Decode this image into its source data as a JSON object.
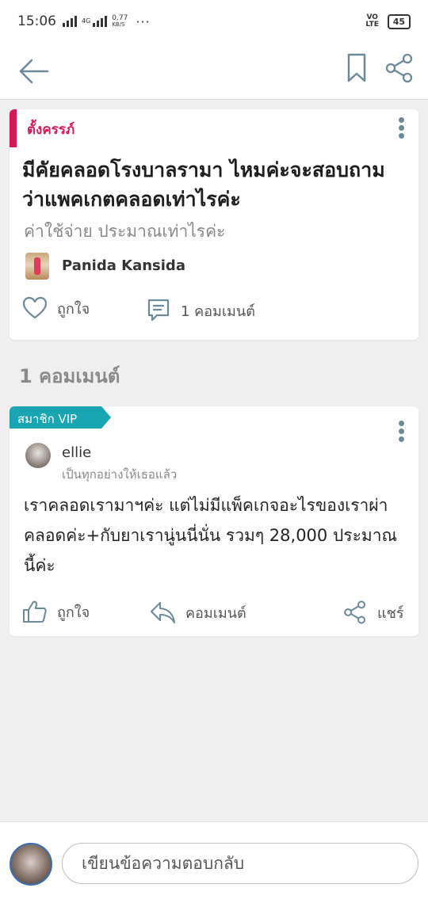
{
  "status_bar": {
    "time": "15:06",
    "network": "4G",
    "speed_value": "0.77",
    "speed_unit": "KB/S",
    "more": "···",
    "volte": "VO LTE",
    "battery": "45"
  },
  "toolbar": {
    "back_icon": "arrow-left-icon",
    "bookmark_icon": "bookmark-icon",
    "share_icon": "share-icon"
  },
  "post": {
    "tag": "ตั้งครรภ์",
    "title": "มีคัยคลอดโรงบาลรามา ไหมค่ะจะสอบถามว่าแพคเกตคลอดเท่าไรค่ะ",
    "subtitle": "ค่าใช้จ่าย ประมาณเท่าไรค่ะ",
    "author": "Panida Kansida",
    "like_label": "ถูกใจ",
    "comment_count_label": "1 คอมเมนต์"
  },
  "comments_section": {
    "title": "1 คอมเมนต์"
  },
  "comment": {
    "badge": "สมาชิก VIP",
    "name": "ellie",
    "status": "เป็นทุกอย่างให้เธอแล้ว",
    "body": "เราคลอดเรามาฯค่ะ แต่ไม่มีแพ็คเกจอะไรของเราผ่าคลอดค่ะ+กับยาเรานู่นนี่นั่น รวมๆ 28,000 ประมาณนี้ค่ะ",
    "like_label": "ถูกใจ",
    "reply_label": "คอมเมนต์",
    "share_label": "แชร์"
  },
  "reply_bar": {
    "placeholder": "เขียนข้อความตอบกลับ"
  },
  "colors": {
    "accent_pink": "#d6185b",
    "vip_teal": "#1aa5b2",
    "icon_gray": "#6b8a99"
  }
}
